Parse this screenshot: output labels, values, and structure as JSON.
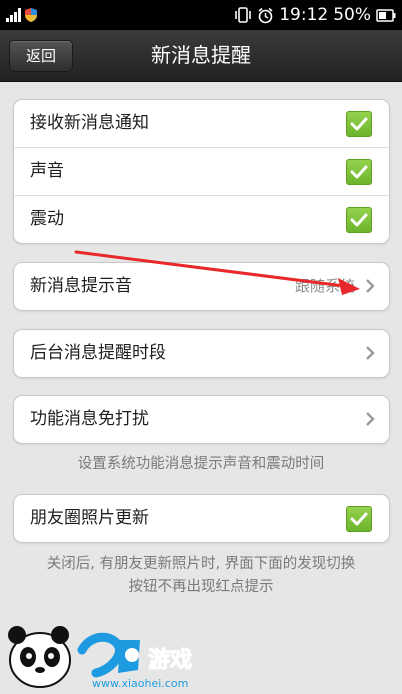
{
  "status_bar": {
    "time": "19:12",
    "battery": "50%",
    "icons": [
      "signal-icon",
      "shield-icon",
      "vibrate-icon",
      "alarm-icon",
      "battery-icon"
    ]
  },
  "header": {
    "back_label": "返回",
    "title": "新消息提醒"
  },
  "group1": {
    "items": [
      {
        "label": "接收新消息通知",
        "checked": true
      },
      {
        "label": "声音",
        "checked": true
      },
      {
        "label": "震动",
        "checked": true
      }
    ]
  },
  "tone": {
    "label": "新消息提示音",
    "value": "跟随系统"
  },
  "background": {
    "label": "后台消息提醒时段"
  },
  "feature": {
    "label": "功能消息免打扰"
  },
  "feature_note": "设置系统功能消息提示声音和震动时间",
  "moments": {
    "label": "朋友圈照片更新",
    "checked": true
  },
  "moments_note": {
    "line1": "关闭后, 有朋友更新照片时, 界面下面的发现切换",
    "line2": "按钮不再出现红点提示"
  },
  "watermark": {
    "brand": "小黑游戏",
    "url": "www.xiaohei.com"
  },
  "colors": {
    "accent_green": "#7dc23a",
    "annotation_arrow": "#e8282a"
  }
}
